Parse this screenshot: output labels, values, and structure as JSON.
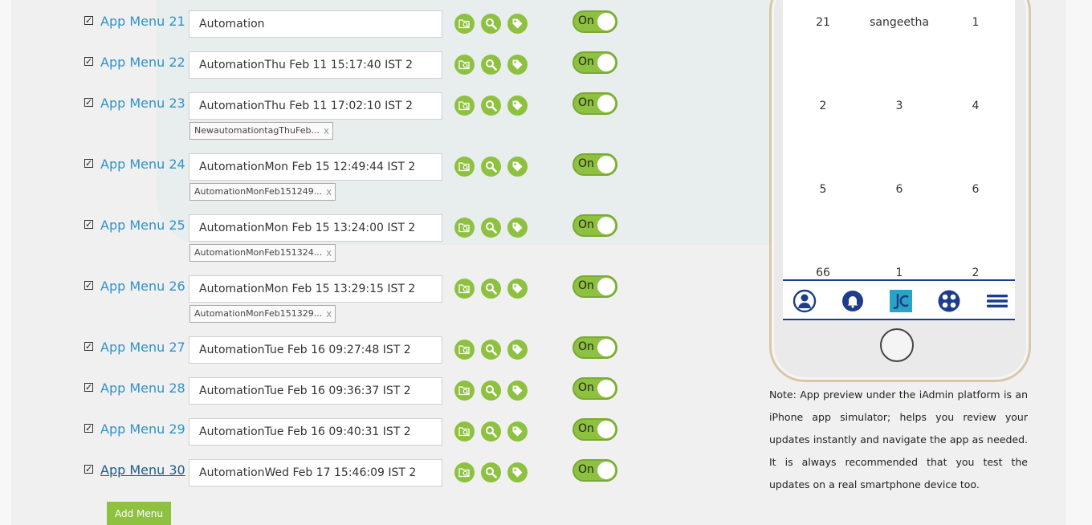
{
  "menus": [
    {
      "label": "App Menu 21",
      "value": "Automation",
      "tag": null,
      "toggle": "On",
      "active": false
    },
    {
      "label": "App Menu 22",
      "value": "AutomationThu Feb 11 15:17:40 IST 2",
      "tag": null,
      "toggle": "On",
      "active": false
    },
    {
      "label": "App Menu 23",
      "value": "AutomationThu Feb 11 17:02:10 IST 2",
      "tag": "NewautomationtagThuFeb...",
      "toggle": "On",
      "active": false
    },
    {
      "label": "App Menu 24",
      "value": "AutomationMon Feb 15 12:49:44 IST 2",
      "tag": "AutomationMonFeb151249...",
      "toggle": "On",
      "active": false
    },
    {
      "label": "App Menu 25",
      "value": "AutomationMon Feb 15 13:24:00 IST 2",
      "tag": "AutomationMonFeb151324...",
      "toggle": "On",
      "active": false
    },
    {
      "label": "App Menu 26",
      "value": "AutomationMon Feb 15 13:29:15 IST 2",
      "tag": "AutomationMonFeb151329...",
      "toggle": "On",
      "active": false
    },
    {
      "label": "App Menu 27",
      "value": "AutomationTue Feb 16 09:27:48 IST 2",
      "tag": null,
      "toggle": "On",
      "active": false
    },
    {
      "label": "App Menu 28",
      "value": "AutomationTue Feb 16 09:36:37 IST 2",
      "tag": null,
      "toggle": "On",
      "active": false
    },
    {
      "label": "App Menu 29",
      "value": "AutomationTue Feb 16 09:40:31 IST 2",
      "tag": null,
      "toggle": "On",
      "active": false
    },
    {
      "label": "App Menu 30",
      "value": "AutomationWed Feb 17 15:46:09 IST 2",
      "tag": null,
      "toggle": "On",
      "active": true
    }
  ],
  "tag_remove": "x",
  "add_menu_label": "Add Menu",
  "phone": {
    "grid": [
      [
        "21",
        "sangeetha",
        "1"
      ],
      [
        "2",
        "3",
        "4"
      ],
      [
        "5",
        "6",
        "6"
      ],
      [
        "66",
        "1",
        "2"
      ]
    ],
    "nav_icons": [
      "user-icon",
      "bell-icon",
      "app-logo-icon",
      "apps-grid-icon",
      "hamburger-menu-icon"
    ]
  },
  "note": "Note: App preview under the iAdmin platform is an iPhone app simulator; helps you review your updates instantly and navigate the app as needed. It is always recommended that you test the updates on a real smartphone device too.",
  "colors": {
    "accent_green": "#8dc13f",
    "link_blue": "#2f93c9",
    "nav_blue": "#1e3c8c"
  }
}
